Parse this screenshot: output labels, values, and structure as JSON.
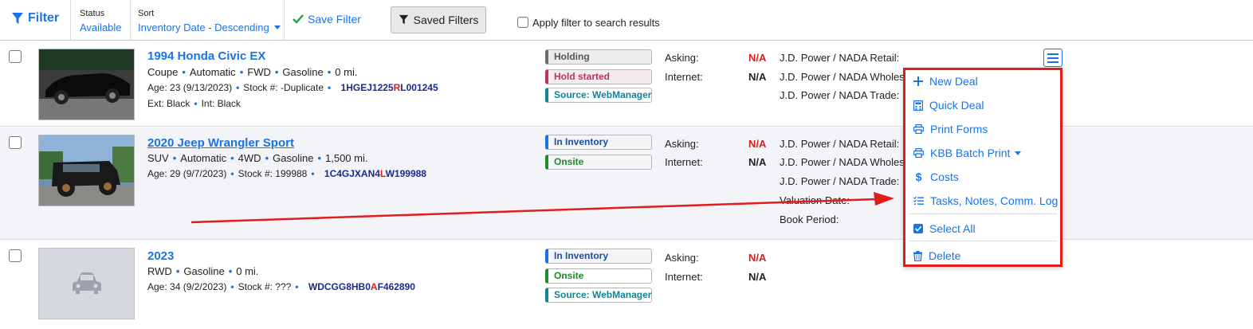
{
  "toolbar": {
    "filter_label": "Filter",
    "status_label": "Status",
    "status_value": "Available",
    "sort_label": "Sort",
    "sort_value": "Inventory Date - Descending",
    "save_filter_label": "Save Filter",
    "saved_filters_label": "Saved Filters",
    "apply_filter_label": "Apply filter to search results"
  },
  "vehicles": [
    {
      "title": "1994 Honda Civic EX",
      "specs": [
        "Coupe",
        "Automatic",
        "FWD",
        "Gasoline",
        "0 mi."
      ],
      "age": "Age: 23 (9/13/2023)",
      "stock": "Stock #: -Duplicate",
      "vin_a": "1HGEJ1225",
      "vin_b": "R",
      "vin_c": "L001245",
      "colors": [
        "Ext: Black",
        "Int: Black"
      ],
      "badges": [
        "Holding",
        "Hold started",
        "Source: WebManager"
      ],
      "asking_label": "Asking:",
      "asking_value": "N/A",
      "internet_label": "Internet:",
      "internet_value": "N/A",
      "valuation_labels": [
        "J.D. Power / NADA Retail:",
        "J.D. Power / NADA Wholes",
        "J.D. Power / NADA Trade:"
      ]
    },
    {
      "title": "2020 Jeep Wrangler Sport",
      "specs": [
        "SUV",
        "Automatic",
        "4WD",
        "Gasoline",
        "1,500 mi."
      ],
      "age": "Age: 29 (9/7/2023)",
      "stock": "Stock #: 199988",
      "vin_a": "1C4GJXAN4",
      "vin_b": "L",
      "vin_c": "W199988",
      "badges": [
        "In Inventory",
        "Onsite"
      ],
      "asking_label": "Asking:",
      "asking_value": "N/A",
      "internet_label": "Internet:",
      "internet_value": "N/A",
      "valuation_labels": [
        "J.D. Power / NADA Retail:",
        "J.D. Power / NADA Wholes",
        "J.D. Power / NADA Trade:",
        "Valuation Date:",
        "Book Period:"
      ]
    },
    {
      "title": "2023",
      "specs": [
        "RWD",
        "Gasoline",
        "0 mi."
      ],
      "age": "Age: 34 (9/2/2023)",
      "stock": "Stock #: ???",
      "vin_a": "WDCGG8HB0",
      "vin_b": "A",
      "vin_c": "F462890",
      "badges": [
        "In Inventory",
        "Onsite",
        "Source: WebManager"
      ],
      "asking_label": "Asking:",
      "asking_value": "N/A",
      "internet_label": "Internet:",
      "internet_value": "N/A"
    }
  ],
  "menu": {
    "items": [
      "New Deal",
      "Quick Deal",
      "Print Forms",
      "KBB Batch Print",
      "Costs",
      "Tasks, Notes, Comm. Log",
      "Select All",
      "Delete"
    ]
  },
  "colors": {
    "accent": "#1a73e8",
    "highlight_red": "#e11d1d",
    "badge_gray": "#6b6b6b",
    "badge_pink": "#b8336a",
    "badge_teal": "#138496",
    "badge_blue": "#1a73e8",
    "badge_green": "#1f8a2e"
  }
}
